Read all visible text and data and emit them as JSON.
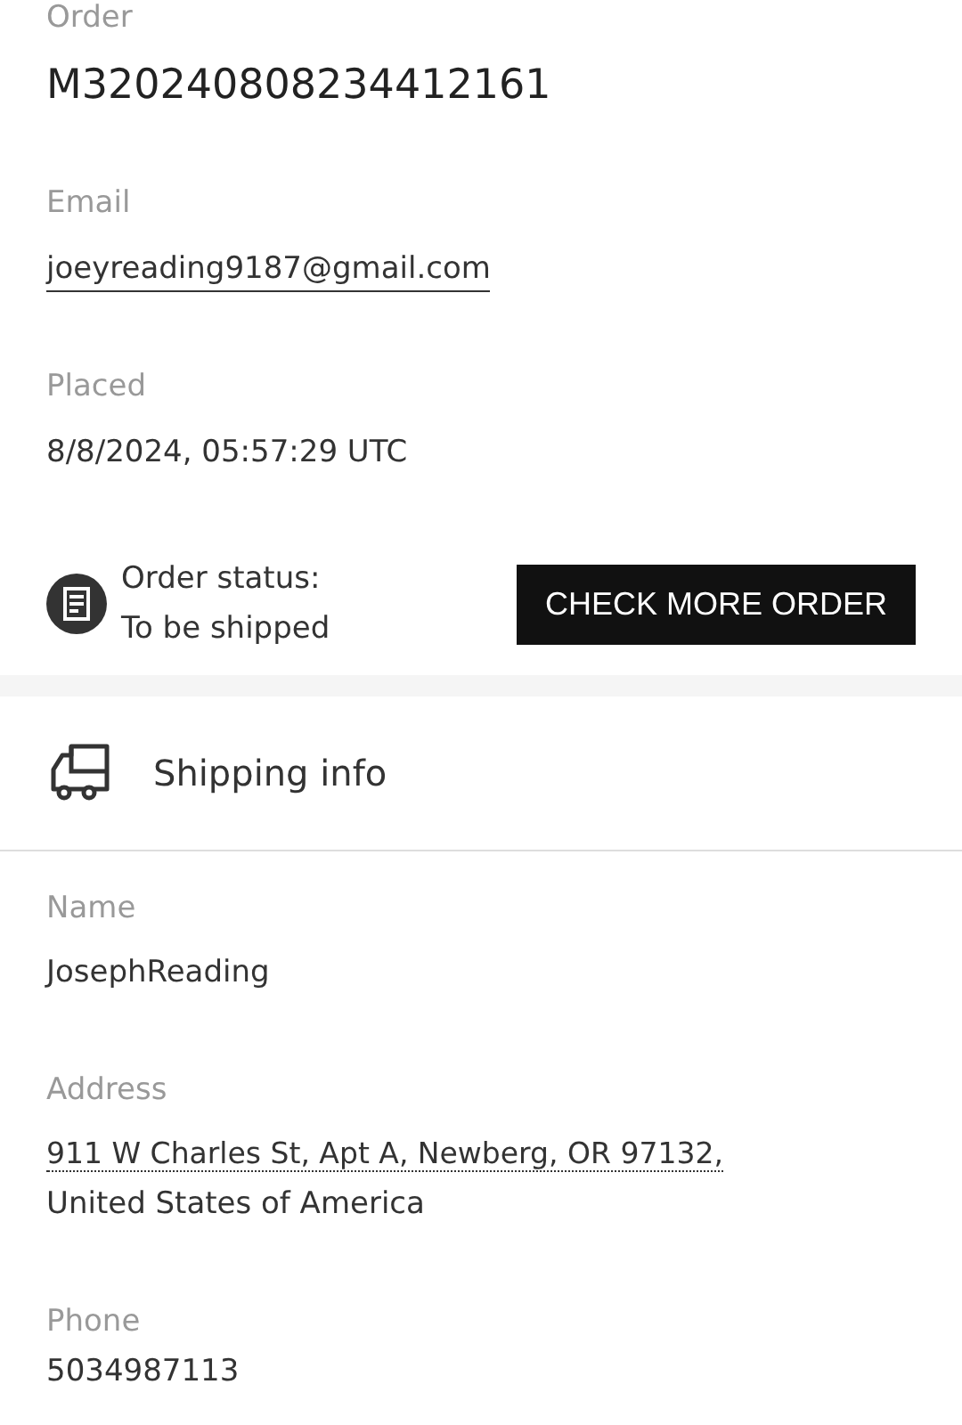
{
  "order_fields": [
    {
      "label": "Order",
      "value": "M320240808234412161",
      "kind": "large"
    },
    {
      "label": "Email",
      "value": "joeyreading9187@gmail.com",
      "kind": "link"
    },
    {
      "label": "Placed",
      "value": "8/8/2024, 05:57:29 UTC",
      "kind": "plain"
    }
  ],
  "status": {
    "label": "Order status:",
    "value": "To be shipped"
  },
  "check_button": "CHECK MORE ORDER",
  "shipping": {
    "title": "Shipping info",
    "fields": [
      {
        "label": "Name",
        "lines": [
          "JosephReading"
        ],
        "kind": "plain"
      },
      {
        "label": "Address",
        "lines": [
          "911 W Charles St, Apt A, Newberg, OR 97132,",
          "United States of America"
        ],
        "kind": "address"
      },
      {
        "label": "Phone",
        "lines": [
          "5034987113"
        ],
        "kind": "plain"
      }
    ]
  }
}
